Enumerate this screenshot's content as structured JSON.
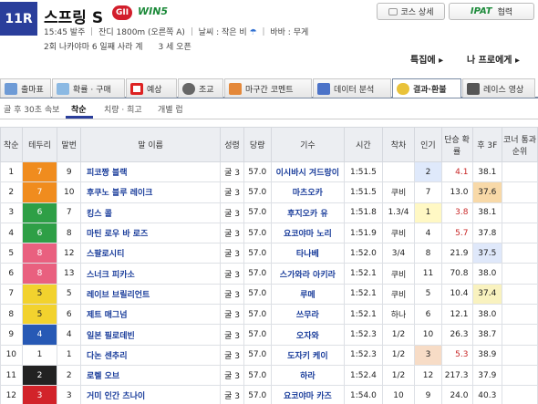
{
  "header": {
    "race_number": "11R",
    "race_name": "스프링 S",
    "grade": "GII",
    "win5": "WIN5",
    "info_line1_a": "15:45 발주",
    "info_line1_b": "잔디 1800m (오른쪽 A)",
    "info_line1_c": "날씨 : 작은 비",
    "info_line1_d": "바바 : 무게",
    "info_line2_a": "2회 나카야마 6 일째 사라 계",
    "info_line2_b": "3 세 오픈",
    "course_button": "코스 상세",
    "ipat_logo": "IPAT",
    "ipat_button": "협력",
    "special_link": "특집에",
    "pro_link": "나 프로에게"
  },
  "tabs": [
    {
      "label": "출마표",
      "icon": "entry-table-icon"
    },
    {
      "label": "확률 · 구매",
      "icon": "odds-table-icon"
    },
    {
      "label": "예상",
      "icon": "target-icon"
    },
    {
      "label": "조교",
      "icon": "stopwatch-icon"
    },
    {
      "label": "마구간 코멘트",
      "icon": "stable-icon"
    },
    {
      "label": "데이터 분석",
      "icon": "chart-icon"
    },
    {
      "label": "결과·환불",
      "icon": "coins-icon",
      "active": true
    },
    {
      "label": "레이스 영상",
      "icon": "video-icon"
    }
  ],
  "subnav": {
    "rear_label": "골 후 30초 속보",
    "items": [
      "착순",
      "치량 · 희고",
      "개별 럽"
    ]
  },
  "columns": [
    "착순",
    "테두리",
    "말번",
    "말 이름",
    "성령",
    "당량",
    "기수",
    "시간",
    "착차",
    "인기",
    "단승 확률",
    "후 3F",
    "코너 통과 순위"
  ],
  "rows": [
    {
      "pos": "1",
      "gate": "7",
      "num": "9",
      "name": "피코짱 블랙",
      "sex": "굴 3",
      "weight": "57.0",
      "jockey": "이시바시 겨드랑이",
      "time": "1:51.5",
      "margin": "",
      "pop": "2",
      "odds": "4.1",
      "f3": "38.1"
    },
    {
      "pos": "2",
      "gate": "7",
      "num": "10",
      "name": "후쿠노 블루 레이크",
      "sex": "굴 3",
      "weight": "57.0",
      "jockey": "마츠오카",
      "time": "1:51.5",
      "margin": "쿠비",
      "pop": "7",
      "odds": "13.0",
      "f3": "37.6"
    },
    {
      "pos": "3",
      "gate": "6",
      "num": "7",
      "name": "킹스 콜",
      "sex": "굴 3",
      "weight": "57.0",
      "jockey": "후지오카 유",
      "time": "1:51.8",
      "margin": "1.3/4",
      "pop": "1",
      "odds": "3.8",
      "f3": "38.1"
    },
    {
      "pos": "4",
      "gate": "6",
      "num": "8",
      "name": "마틴 로우 바 로즈",
      "sex": "굴 3",
      "weight": "57.0",
      "jockey": "요코야마 노리",
      "time": "1:51.9",
      "margin": "쿠비",
      "pop": "4",
      "odds": "5.7",
      "f3": "37.8"
    },
    {
      "pos": "5",
      "gate": "8",
      "num": "12",
      "name": "스팔로시티",
      "sex": "굴 3",
      "weight": "57.0",
      "jockey": "타나베",
      "time": "1:52.0",
      "margin": "3/4",
      "pop": "8",
      "odds": "21.9",
      "f3": "37.5"
    },
    {
      "pos": "6",
      "gate": "8",
      "num": "13",
      "name": "스너크 피카소",
      "sex": "굴 3",
      "weight": "57.0",
      "jockey": "스가와라 아키라",
      "time": "1:52.1",
      "margin": "쿠비",
      "pop": "11",
      "odds": "70.8",
      "f3": "38.0"
    },
    {
      "pos": "7",
      "gate": "5",
      "num": "5",
      "name": "레이브 브릴리언트",
      "sex": "굴 3",
      "weight": "57.0",
      "jockey": "루메",
      "time": "1:52.1",
      "margin": "쿠비",
      "pop": "5",
      "odds": "10.4",
      "f3": "37.4"
    },
    {
      "pos": "8",
      "gate": "5",
      "num": "6",
      "name": "제트 매그넘",
      "sex": "굴 3",
      "weight": "57.0",
      "jockey": "쓰무라",
      "time": "1:52.1",
      "margin": "하나",
      "pop": "6",
      "odds": "12.1",
      "f3": "38.0"
    },
    {
      "pos": "9",
      "gate": "4",
      "num": "4",
      "name": "일본 필로데빈",
      "sex": "굴 3",
      "weight": "57.0",
      "jockey": "오자와",
      "time": "1:52.3",
      "margin": "1/2",
      "pop": "10",
      "odds": "26.3",
      "f3": "38.7"
    },
    {
      "pos": "10",
      "gate": "1",
      "num": "1",
      "name": "다논 센추리",
      "sex": "굴 3",
      "weight": "57.0",
      "jockey": "도자키 케이",
      "time": "1:52.3",
      "margin": "1/2",
      "pop": "3",
      "odds": "5.3",
      "f3": "38.9"
    },
    {
      "pos": "11",
      "gate": "2",
      "num": "2",
      "name": "로렐 오브",
      "sex": "굴 3",
      "weight": "57.0",
      "jockey": "하라",
      "time": "1:52.4",
      "margin": "1/2",
      "pop": "12",
      "odds": "217.3",
      "f3": "37.9"
    },
    {
      "pos": "12",
      "gate": "3",
      "num": "3",
      "name": "거미 인간 츠나이",
      "sex": "굴 3",
      "weight": "57.0",
      "jockey": "요코야마 카즈",
      "time": "1:54.0",
      "margin": "10",
      "pop": "9",
      "odds": "24.0",
      "f3": "40.3"
    }
  ],
  "colors": {
    "navy": "#2a3e9b",
    "grade_red": "#d21e2b",
    "link_blue": "#1a3d9b",
    "fav_red": "#c82727"
  }
}
